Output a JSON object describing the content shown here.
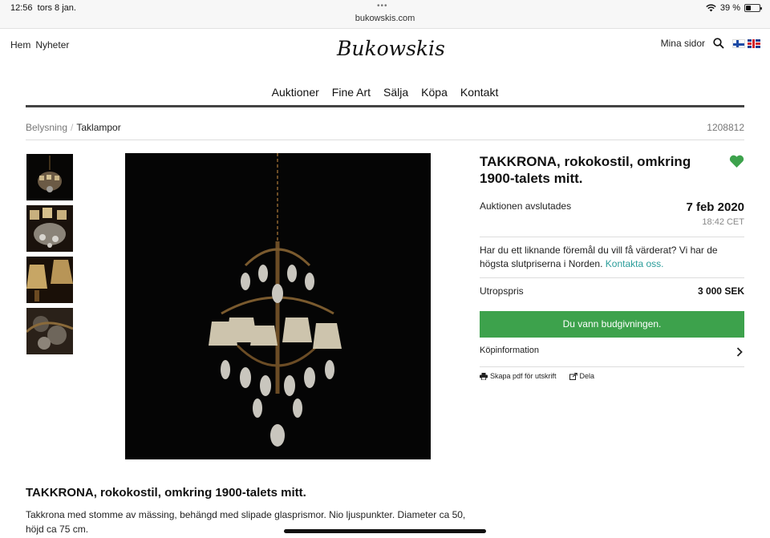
{
  "status_bar": {
    "time": "12:56",
    "date": "tors 8 jan.",
    "url": "bukowskis.com",
    "battery": "39 %",
    "battery_level": 0.39
  },
  "header": {
    "left_links": [
      "Hem",
      "Nyheter"
    ],
    "logo_text": "Bukowskis",
    "my_pages": "Mina sidor",
    "icons": [
      "search-icon",
      "flag-finland-icon",
      "flag-uk-icon"
    ]
  },
  "main_nav": [
    "Auktioner",
    "Fine Art",
    "Sälja",
    "Köpa",
    "Kontakt"
  ],
  "breadcrumb": {
    "category": "Belysning",
    "separator": "/",
    "current": "Taklampor",
    "lot_number": "1208812"
  },
  "lot": {
    "title": "TAKKRONA, rokokostil, omkring 1900-talets mitt.",
    "auction_end_label": "Auktionen avslutades",
    "auction_end_date": "7 feb 2020",
    "auction_end_time": "18:42 CET",
    "valuation_text": "Har du ett liknande föremål du vill få värderat? Vi har de högsta slutpriserna i Norden.",
    "valuation_link": "Kontakta oss.",
    "estimate_label": "Utropspris",
    "estimate_value": "3 000 SEK",
    "won_button": "Du vann budgivningen.",
    "buy_info": "Köpinformation",
    "pdf_action": "Skapa pdf för utskrift",
    "share_action": "Dela"
  },
  "description": {
    "title": "TAKKRONA, rokokostil, omkring 1900-talets mitt.",
    "text": "Takkrona med stomme av mässing, behängd med slipade glasprismor. Nio ljuspunkter. Diameter ca 50, höjd ca 75 cm."
  },
  "colors": {
    "accent_green": "#3da24c",
    "link_teal": "#2a9d9a",
    "heart_green": "#3da24c"
  }
}
